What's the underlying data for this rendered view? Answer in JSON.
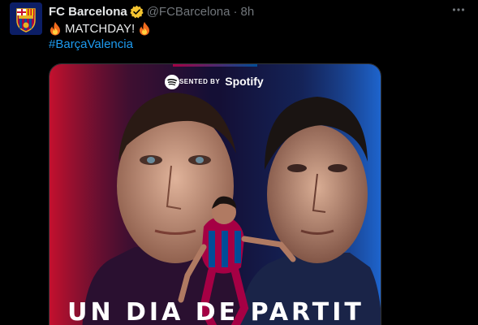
{
  "tweet": {
    "author_name": "FC Barcelona",
    "handle": "@FCBarcelona",
    "separator": "·",
    "time": "8h",
    "text": "MATCHDAY!",
    "hashtag": "#BarçaValencia"
  },
  "media": {
    "presented_by": "PRESENTED BY",
    "sponsor": "Spotify",
    "headline": "UN DIA DE PARTIT"
  },
  "icons": {
    "avatar": "fc-barcelona-crest-icon",
    "verified": "verified-badge-icon",
    "more": "more-options-icon",
    "fire": "fire-emoji-icon",
    "sponsor": "spotify-icon"
  },
  "colors": {
    "background": "#000000",
    "text": "#e7e9ea",
    "muted": "#71767b",
    "link": "#1d9bf0",
    "verified": "#f4c430",
    "blaugrana_red": "#a50044",
    "blaugrana_blue": "#004d98"
  }
}
